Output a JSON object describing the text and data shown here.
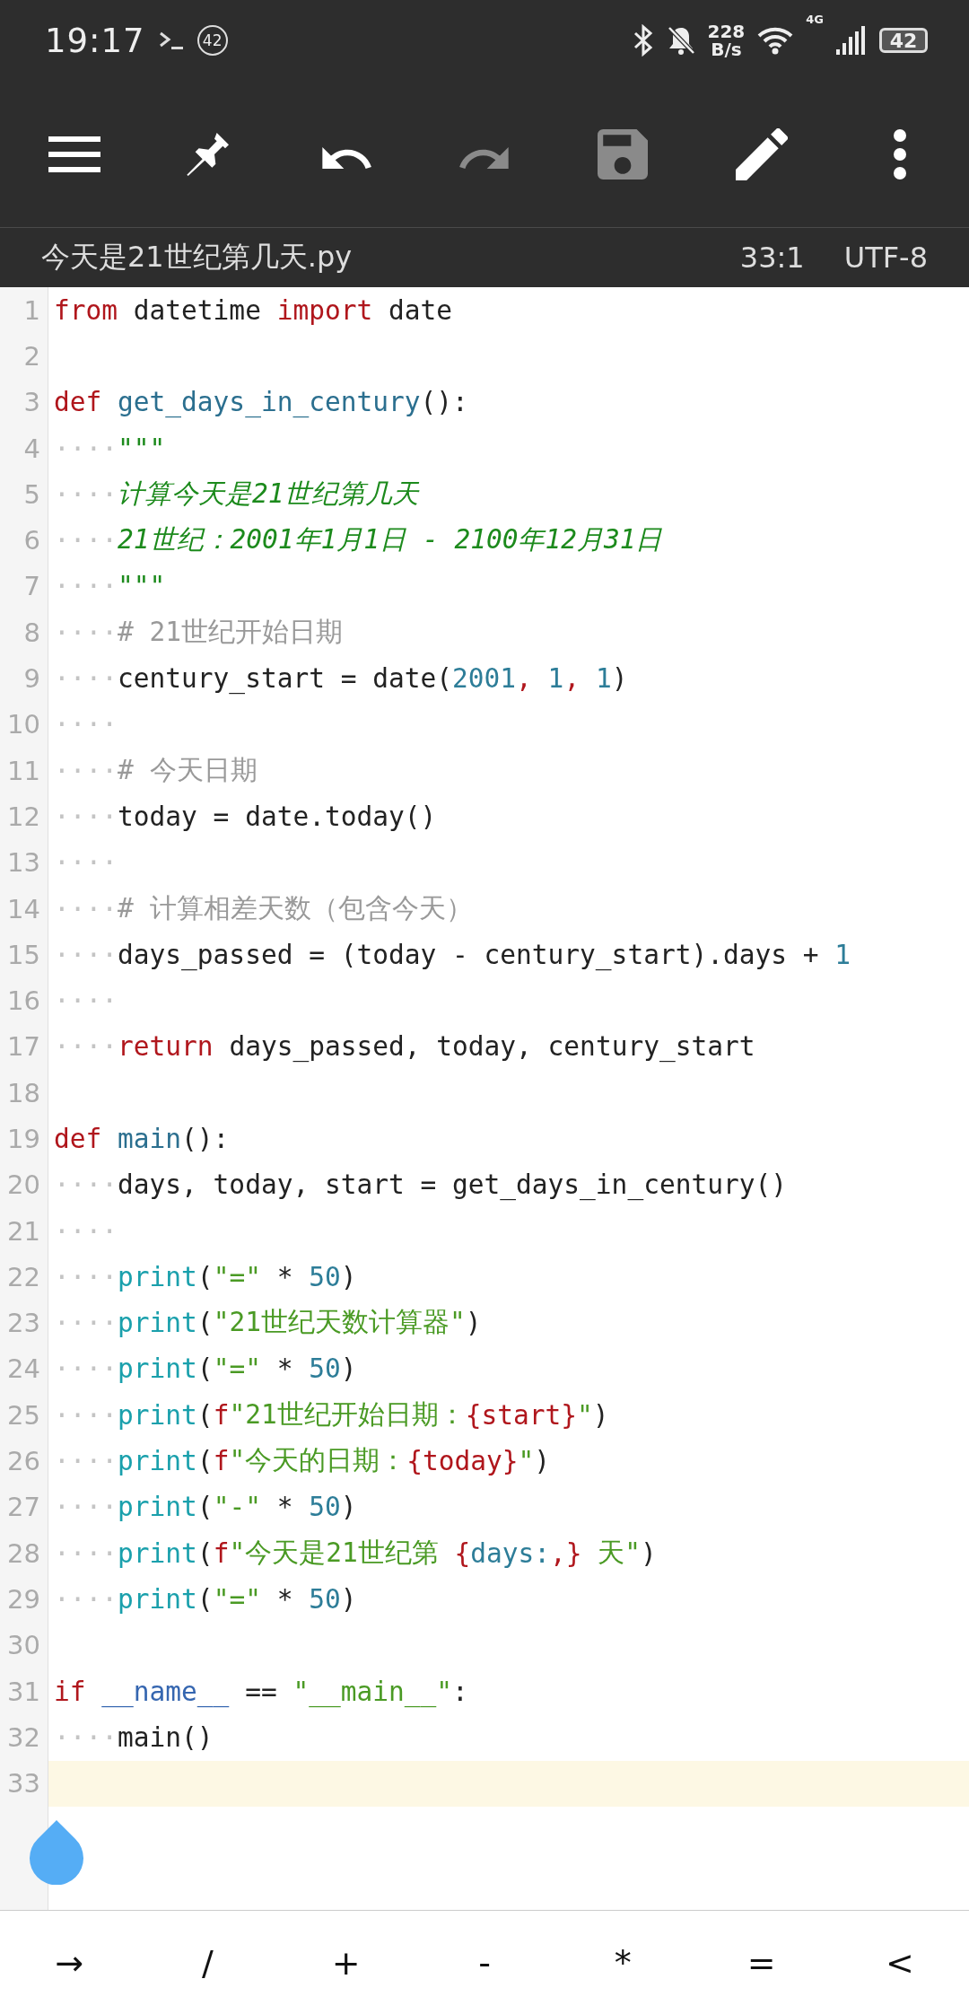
{
  "status_bar": {
    "time": "19:17",
    "notification_count": "42",
    "speed": "228",
    "speed_unit": "B/s",
    "network": "4G",
    "battery": "42"
  },
  "toolbar": [
    {
      "kind": "menu",
      "disabled": false
    },
    {
      "kind": "pin",
      "disabled": false
    },
    {
      "kind": "undo",
      "disabled": false
    },
    {
      "kind": "redo",
      "disabled": true
    },
    {
      "kind": "save",
      "disabled": true
    },
    {
      "kind": "edit",
      "disabled": false
    },
    {
      "kind": "more",
      "disabled": false
    }
  ],
  "file_bar": {
    "filename": "今天是21世纪第几天.py",
    "position": "33:1",
    "encoding": "UTF-8"
  },
  "lines": [
    {
      "number": "1",
      "current": false,
      "tokens": [
        {
          "kind": "keyword",
          "text": "from"
        },
        {
          "kind": "plain",
          "text": " datetime "
        },
        {
          "kind": "keyword",
          "text": "import"
        },
        {
          "kind": "plain",
          "text": " date"
        }
      ]
    },
    {
      "number": "2",
      "current": false
    },
    {
      "number": "3",
      "current": false,
      "tokens": [
        {
          "kind": "keyword",
          "text": "def "
        },
        {
          "kind": "function",
          "text": "get_days_in_century"
        },
        {
          "kind": "plain",
          "text": "():"
        }
      ]
    },
    {
      "number": "4",
      "current": false,
      "tokens": [
        {
          "kind": "space",
          "text": "····"
        },
        {
          "kind": "docstring",
          "text": "\"\"\""
        }
      ]
    },
    {
      "number": "5",
      "current": false,
      "tokens": [
        {
          "kind": "space",
          "text": "····"
        },
        {
          "kind": "docstring",
          "text": "计算今天是21世纪第几天"
        }
      ]
    },
    {
      "number": "6",
      "current": false,
      "tokens": [
        {
          "kind": "space",
          "text": "····"
        },
        {
          "kind": "docstring",
          "text": "21世纪：2001年1月1日 - 2100年12月31日"
        }
      ]
    },
    {
      "number": "7",
      "current": false,
      "tokens": [
        {
          "kind": "space",
          "text": "····"
        },
        {
          "kind": "docstring",
          "text": "\"\"\""
        }
      ]
    },
    {
      "number": "8",
      "current": false,
      "tokens": [
        {
          "kind": "space",
          "text": "····"
        },
        {
          "kind": "comment",
          "text": "# 21世纪开始日期"
        }
      ]
    },
    {
      "number": "9",
      "current": false,
      "tokens": [
        {
          "kind": "space",
          "text": "····"
        },
        {
          "kind": "plain",
          "text": "century_start = date("
        },
        {
          "kind": "number",
          "text": "2001"
        },
        {
          "kind": "punct",
          "text": ", "
        },
        {
          "kind": "number",
          "text": "1"
        },
        {
          "kind": "punct",
          "text": ", "
        },
        {
          "kind": "number",
          "text": "1"
        },
        {
          "kind": "plain",
          "text": ")"
        }
      ]
    },
    {
      "number": "10",
      "current": false,
      "tokens": [
        {
          "kind": "space",
          "text": "····"
        }
      ]
    },
    {
      "number": "11",
      "current": false,
      "tokens": [
        {
          "kind": "space",
          "text": "····"
        },
        {
          "kind": "comment",
          "text": "# 今天日期"
        }
      ]
    },
    {
      "number": "12",
      "current": false,
      "tokens": [
        {
          "kind": "space",
          "text": "····"
        },
        {
          "kind": "plain",
          "text": "today = date.today()"
        }
      ]
    },
    {
      "number": "13",
      "current": false,
      "tokens": [
        {
          "kind": "space",
          "text": "····"
        }
      ]
    },
    {
      "number": "14",
      "current": false,
      "tokens": [
        {
          "kind": "space",
          "text": "····"
        },
        {
          "kind": "comment",
          "text": "# 计算相差天数（包含今天）"
        }
      ]
    },
    {
      "number": "15",
      "current": false,
      "tokens": [
        {
          "kind": "space",
          "text": "····"
        },
        {
          "kind": "plain",
          "text": "days_passed = (today - century_start).days + "
        },
        {
          "kind": "number",
          "text": "1"
        }
      ]
    },
    {
      "number": "16",
      "current": false,
      "tokens": [
        {
          "kind": "space",
          "text": "····"
        }
      ]
    },
    {
      "number": "17",
      "current": false,
      "tokens": [
        {
          "kind": "space",
          "text": "····"
        },
        {
          "kind": "keyword",
          "text": "return"
        },
        {
          "kind": "plain",
          "text": " days_passed, today, century_start"
        }
      ]
    },
    {
      "number": "18",
      "current": false
    },
    {
      "number": "19",
      "current": false,
      "tokens": [
        {
          "kind": "keyword",
          "text": "def "
        },
        {
          "kind": "function",
          "text": "main"
        },
        {
          "kind": "plain",
          "text": "():"
        }
      ]
    },
    {
      "number": "20",
      "current": false,
      "tokens": [
        {
          "kind": "space",
          "text": "····"
        },
        {
          "kind": "plain",
          "text": "days, today, start = get_days_in_century()"
        }
      ]
    },
    {
      "number": "21",
      "current": false,
      "tokens": [
        {
          "kind": "space",
          "text": "····"
        }
      ]
    },
    {
      "number": "22",
      "current": false,
      "tokens": [
        {
          "kind": "space",
          "text": "····"
        },
        {
          "kind": "builtin",
          "text": "print"
        },
        {
          "kind": "plain",
          "text": "("
        },
        {
          "kind": "string",
          "text": "\"=\""
        },
        {
          "kind": "plain",
          "text": " * "
        },
        {
          "kind": "number",
          "text": "50"
        },
        {
          "kind": "plain",
          "text": ")"
        }
      ]
    },
    {
      "number": "23",
      "current": false,
      "tokens": [
        {
          "kind": "space",
          "text": "····"
        },
        {
          "kind": "builtin",
          "text": "print"
        },
        {
          "kind": "plain",
          "text": "("
        },
        {
          "kind": "string",
          "text": "\"21世纪天数计算器\""
        },
        {
          "kind": "plain",
          "text": ")"
        }
      ]
    },
    {
      "number": "24",
      "current": false,
      "tokens": [
        {
          "kind": "space",
          "text": "····"
        },
        {
          "kind": "builtin",
          "text": "print"
        },
        {
          "kind": "plain",
          "text": "("
        },
        {
          "kind": "string",
          "text": "\"=\""
        },
        {
          "kind": "plain",
          "text": " * "
        },
        {
          "kind": "number",
          "text": "50"
        },
        {
          "kind": "plain",
          "text": ")"
        }
      ]
    },
    {
      "number": "25",
      "current": false,
      "tokens": [
        {
          "kind": "space",
          "text": "····"
        },
        {
          "kind": "builtin",
          "text": "print"
        },
        {
          "kind": "plain",
          "text": "("
        },
        {
          "kind": "punct",
          "text": "f"
        },
        {
          "kind": "string",
          "text": "\"21世纪开始日期："
        },
        {
          "kind": "punct",
          "text": "{start}"
        },
        {
          "kind": "string",
          "text": "\""
        },
        {
          "kind": "plain",
          "text": ")"
        }
      ]
    },
    {
      "number": "26",
      "current": false,
      "tokens": [
        {
          "kind": "space",
          "text": "····"
        },
        {
          "kind": "builtin",
          "text": "print"
        },
        {
          "kind": "plain",
          "text": "("
        },
        {
          "kind": "punct",
          "text": "f"
        },
        {
          "kind": "string",
          "text": "\"今天的日期："
        },
        {
          "kind": "punct",
          "text": "{today}"
        },
        {
          "kind": "string",
          "text": "\""
        },
        {
          "kind": "plain",
          "text": ")"
        }
      ]
    },
    {
      "number": "27",
      "current": false,
      "tokens": [
        {
          "kind": "space",
          "text": "····"
        },
        {
          "kind": "builtin",
          "text": "print"
        },
        {
          "kind": "plain",
          "text": "("
        },
        {
          "kind": "string",
          "text": "\"-\""
        },
        {
          "kind": "plain",
          "text": " * "
        },
        {
          "kind": "number",
          "text": "50"
        },
        {
          "kind": "plain",
          "text": ")"
        }
      ]
    },
    {
      "number": "28",
      "current": false,
      "tokens": [
        {
          "kind": "space",
          "text": "····"
        },
        {
          "kind": "builtin",
          "text": "print"
        },
        {
          "kind": "plain",
          "text": "("
        },
        {
          "kind": "punct",
          "text": "f"
        },
        {
          "kind": "string",
          "text": "\"今天是21世纪第 "
        },
        {
          "kind": "punct",
          "text": "{"
        },
        {
          "kind": "number",
          "text": "days:"
        },
        {
          "kind": "punct",
          "text": ",}"
        },
        {
          "kind": "string",
          "text": " 天\""
        },
        {
          "kind": "plain",
          "text": ")"
        }
      ]
    },
    {
      "number": "29",
      "current": false,
      "tokens": [
        {
          "kind": "space",
          "text": "····"
        },
        {
          "kind": "builtin",
          "text": "print"
        },
        {
          "kind": "plain",
          "text": "("
        },
        {
          "kind": "string",
          "text": "\"=\""
        },
        {
          "kind": "plain",
          "text": " * "
        },
        {
          "kind": "number",
          "text": "50"
        },
        {
          "kind": "plain",
          "text": ")"
        }
      ]
    },
    {
      "number": "30",
      "current": false
    },
    {
      "number": "31",
      "current": false,
      "tokens": [
        {
          "kind": "keyword",
          "text": "if "
        },
        {
          "kind": "dunder",
          "text": "__name__"
        },
        {
          "kind": "plain",
          "text": " == "
        },
        {
          "kind": "string",
          "text": "\"__main__\""
        },
        {
          "kind": "plain",
          "text": ":"
        }
      ]
    },
    {
      "number": "32",
      "current": false,
      "tokens": [
        {
          "kind": "space",
          "text": "····"
        },
        {
          "kind": "plain",
          "text": "main()"
        }
      ]
    },
    {
      "number": "33",
      "current": true
    }
  ],
  "keys": [
    "→",
    "/",
    "+",
    "-",
    "*",
    "=",
    "<"
  ]
}
